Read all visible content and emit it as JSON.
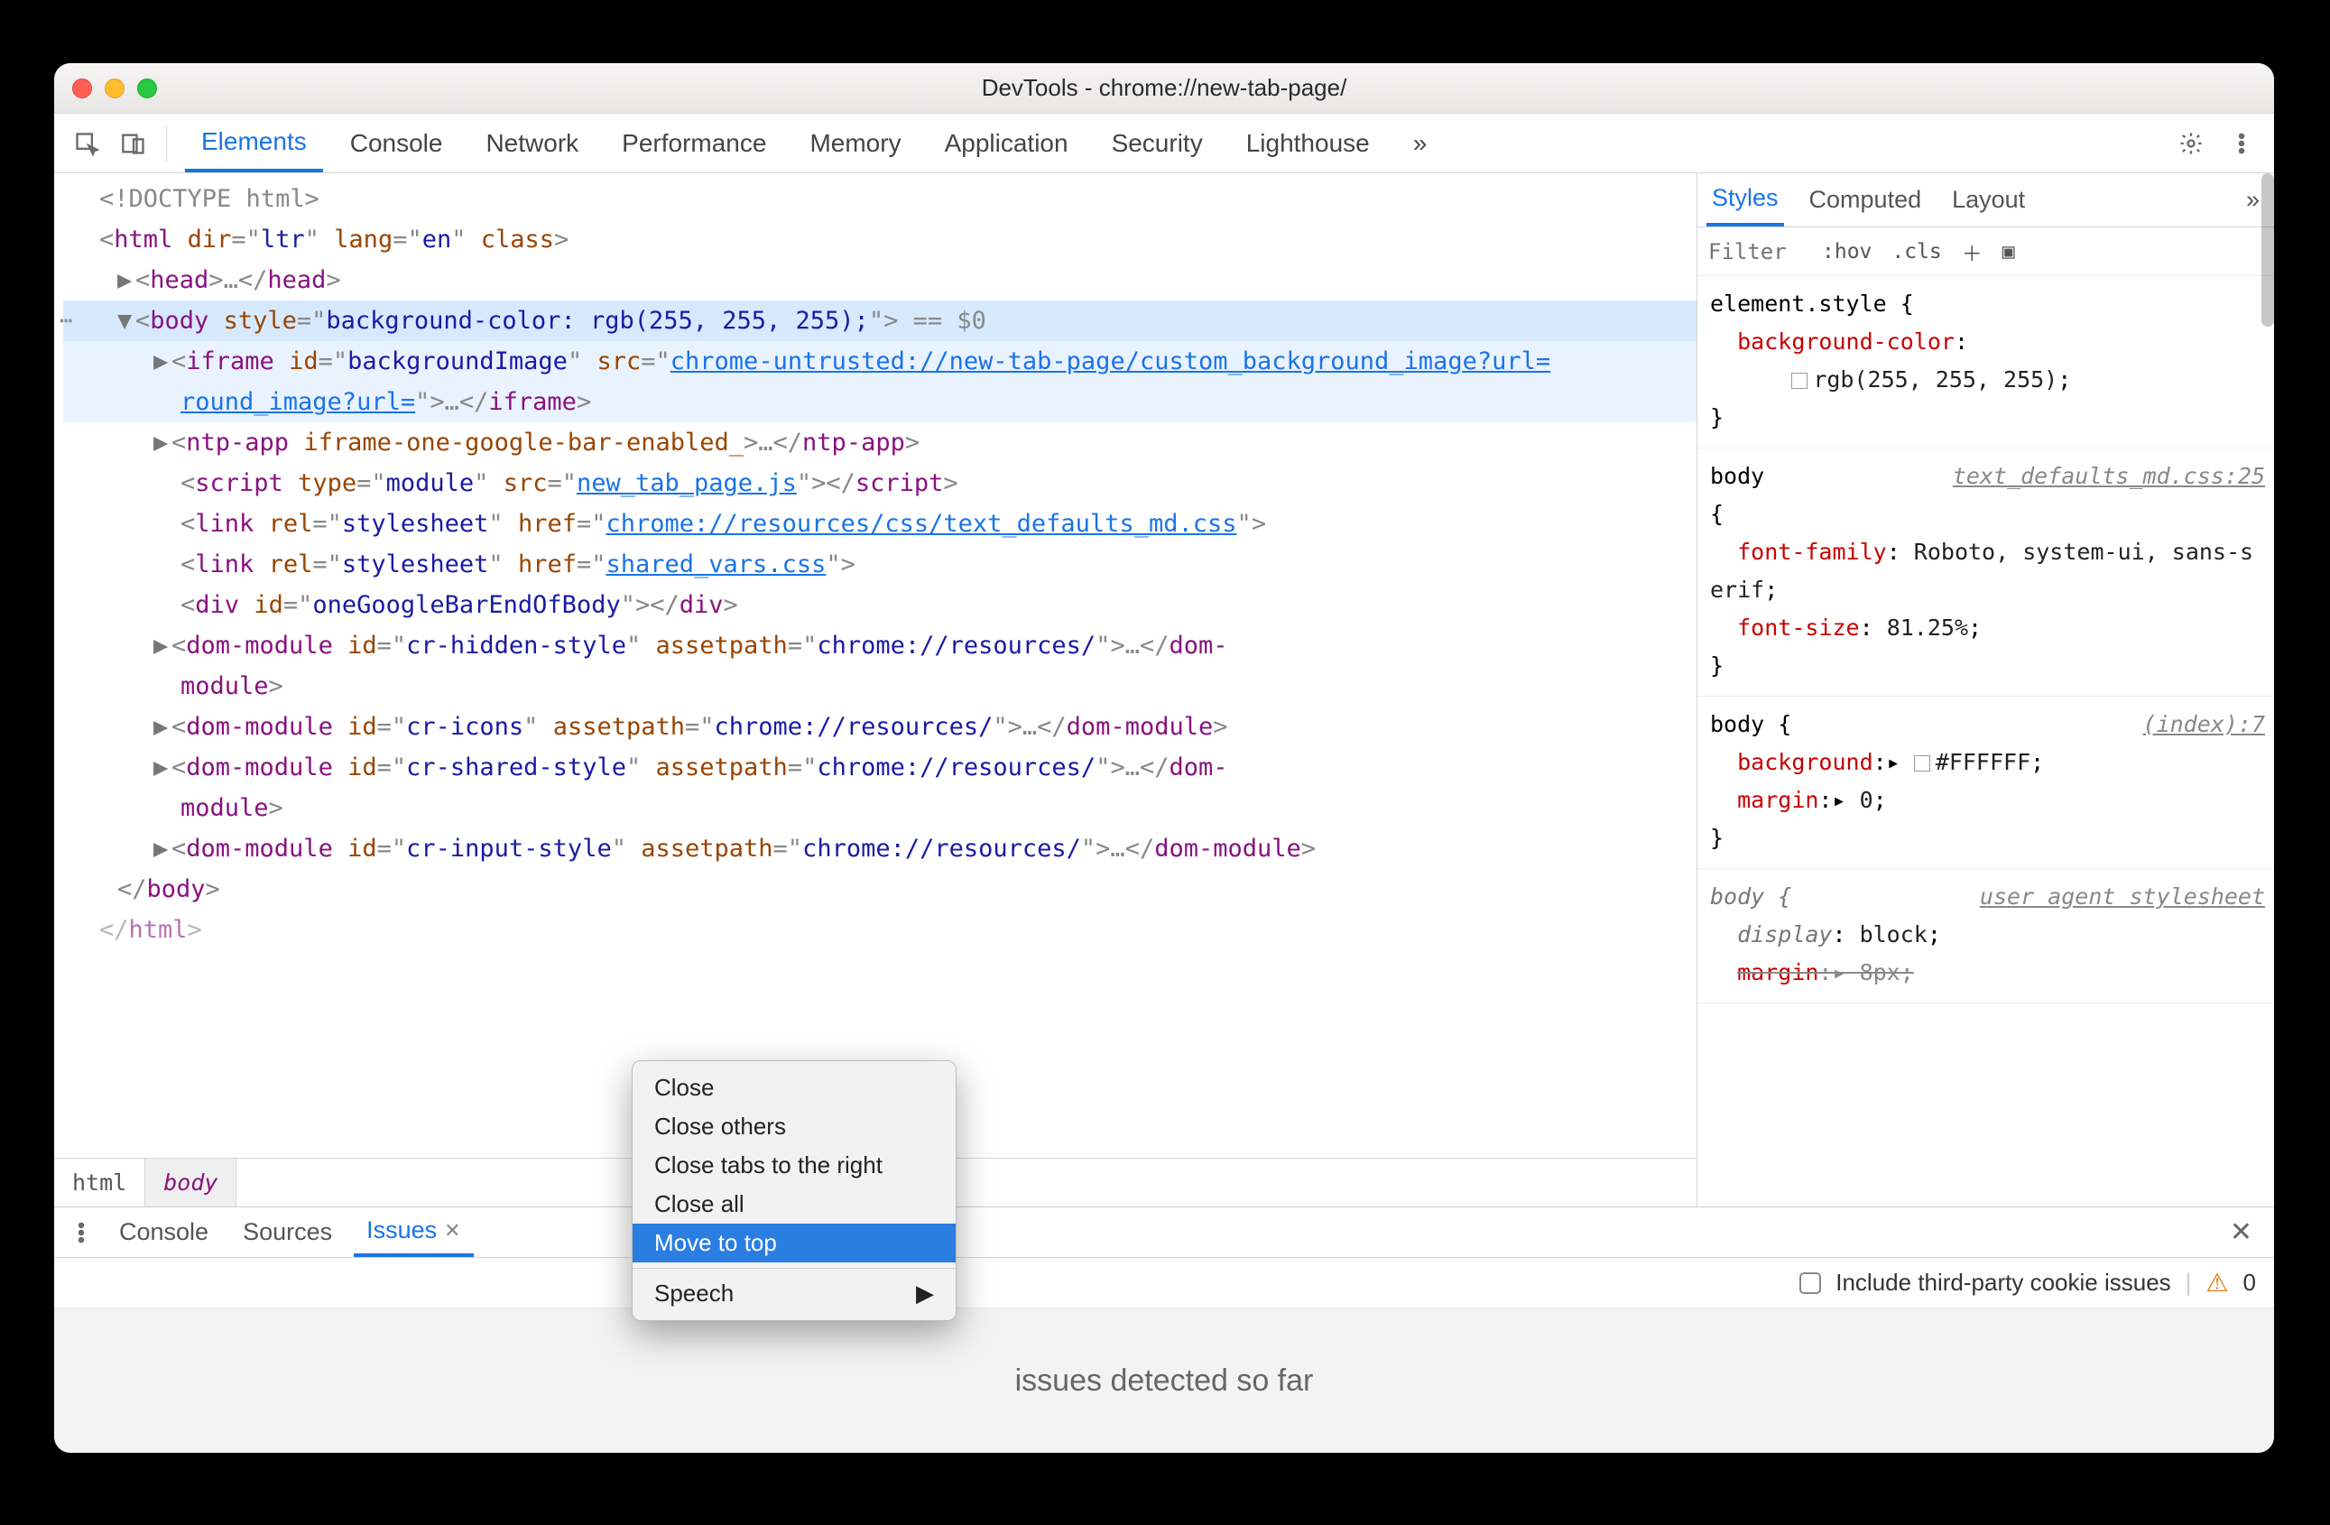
{
  "window": {
    "title": "DevTools - chrome://new-tab-page/"
  },
  "toolbar": {
    "tabs": [
      "Elements",
      "Console",
      "Network",
      "Performance",
      "Memory",
      "Application",
      "Security",
      "Lighthouse"
    ],
    "more": "»"
  },
  "dom": {
    "doctype": "<!DOCTYPE html>",
    "html_attrs": {
      "dir": "ltr",
      "lang": "en"
    },
    "head": {
      "ellipsis": "…"
    },
    "body_sel": {
      "style": "background-color: rgb(255, 255, 255);",
      "suffix": " == $0"
    },
    "children": {
      "iframe": {
        "id": "backgroundImage",
        "src": "chrome-untrusted://new-tab-page/custom_background_image?url=",
        "tail": "…"
      },
      "ntp_app": {
        "attr": "iframe-one-google-bar-enabled_",
        "tail": "…"
      },
      "script": {
        "type": "module",
        "src": "new_tab_page.js"
      },
      "link1": {
        "rel": "stylesheet",
        "href": "chrome://resources/css/text_defaults_md.css"
      },
      "link2": {
        "rel": "stylesheet",
        "href": "shared_vars.css"
      },
      "div": {
        "id": "oneGoogleBarEndOfBody"
      },
      "dm1": {
        "id": "cr-hidden-style",
        "assetpath": "chrome://resources/"
      },
      "dm2": {
        "id": "cr-icons",
        "assetpath": "chrome://resources/"
      },
      "dm3": {
        "id": "cr-shared-style",
        "assetpath": "chrome://resources/"
      },
      "dm4": {
        "id": "cr-input-style",
        "assetpath": "chrome://resources/"
      }
    }
  },
  "crumbs": [
    "html",
    "body"
  ],
  "styles": {
    "tabs": [
      "Styles",
      "Computed",
      "Layout"
    ],
    "filter_placeholder": "Filter",
    "hov": ":hov",
    "cls": ".cls",
    "rules": {
      "element_style": {
        "selector": "element.style {",
        "props": [
          {
            "n": "background-color",
            "v": "rgb(255, 255, 255)",
            "swatch": "#ffffff"
          }
        ]
      },
      "body_md": {
        "selector": "body",
        "src": "text_defaults_md.css:25",
        "props": [
          {
            "n": "font-family",
            "v": "Roboto, system-ui, sans-serif"
          },
          {
            "n": "font-size",
            "v": "81.25%"
          }
        ]
      },
      "body_index": {
        "selector": "body {",
        "src": "(index):7",
        "props": [
          {
            "n": "background",
            "v": "#FFFFFF",
            "tri": true,
            "swatch": "#ffffff"
          },
          {
            "n": "margin",
            "v": "0",
            "tri": true
          }
        ]
      },
      "body_ua": {
        "selector": "body {",
        "src": "user agent stylesheet",
        "props": [
          {
            "n": "display",
            "v": "block"
          },
          {
            "n": "margin",
            "v": "8px",
            "strike": true
          }
        ]
      }
    }
  },
  "drawer": {
    "tabs": [
      "Console",
      "Sources",
      "Issues"
    ],
    "active": "Issues",
    "include_third_party": "Include third-party cookie issues",
    "issues_count": "0",
    "body_message": "issues detected so far"
  },
  "context_menu": {
    "items": [
      "Close",
      "Close others",
      "Close tabs to the right",
      "Close all",
      "Move to top"
    ],
    "highlight": "Move to top",
    "speech": "Speech"
  }
}
